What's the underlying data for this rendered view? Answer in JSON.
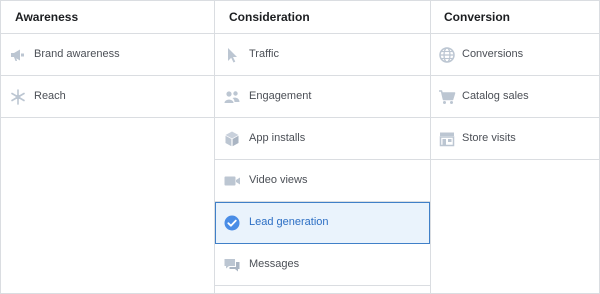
{
  "colors": {
    "icon": "#bcc6d2",
    "selected_text": "#2d6fc4",
    "selected_bg": "#eaf3fc",
    "check": "#4a8de6"
  },
  "columns": [
    {
      "title": "Awareness",
      "items": [
        {
          "label": "Brand awareness",
          "icon": "megaphone-icon"
        },
        {
          "label": "Reach",
          "icon": "snowflake-icon"
        }
      ]
    },
    {
      "title": "Consideration",
      "items": [
        {
          "label": "Traffic",
          "icon": "cursor-icon"
        },
        {
          "label": "Engagement",
          "icon": "people-icon"
        },
        {
          "label": "App installs",
          "icon": "box-icon"
        },
        {
          "label": "Video views",
          "icon": "video-camera-icon"
        },
        {
          "label": "Lead generation",
          "icon": "check-circle-icon",
          "selected": true
        },
        {
          "label": "Messages",
          "icon": "chat-bubbles-icon"
        }
      ]
    },
    {
      "title": "Conversion",
      "items": [
        {
          "label": "Conversions",
          "icon": "globe-icon"
        },
        {
          "label": "Catalog sales",
          "icon": "shopping-cart-icon"
        },
        {
          "label": "Store visits",
          "icon": "storefront-icon"
        }
      ]
    }
  ]
}
